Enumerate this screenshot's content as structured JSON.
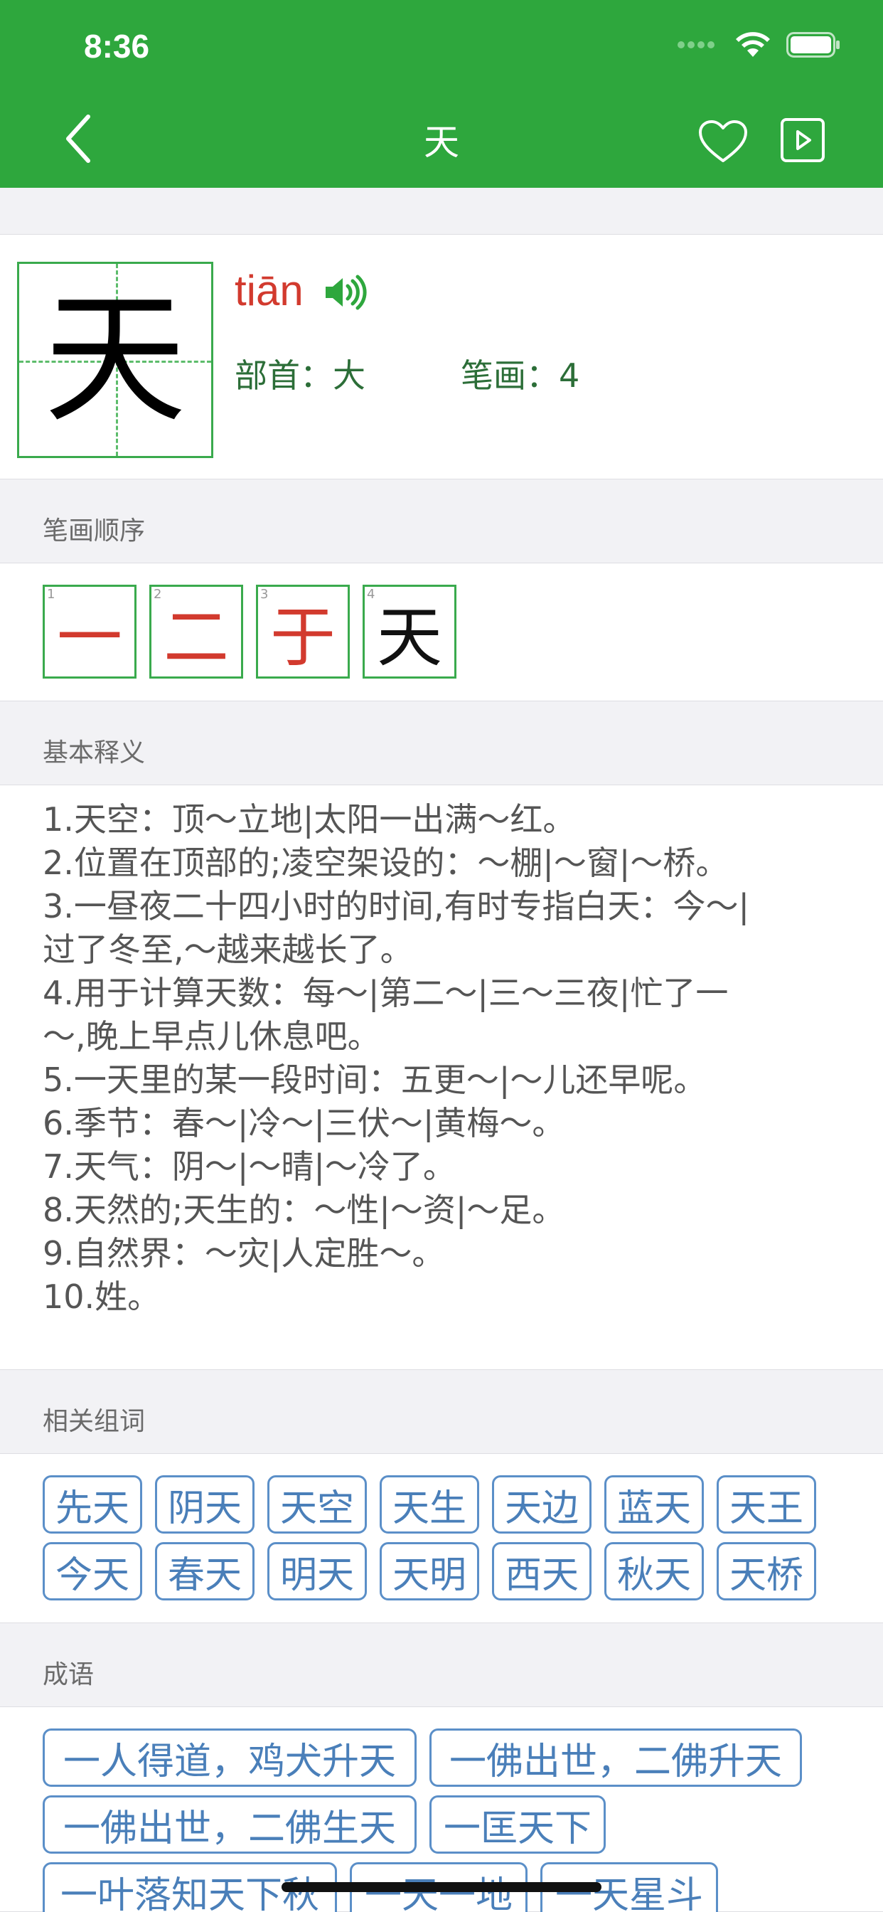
{
  "status_bar": {
    "time": "8:36"
  },
  "nav": {
    "title": "天"
  },
  "character": {
    "glyph": "天",
    "pinyin": "tiān",
    "radical_label": "部首：大",
    "strokes_label": "笔画：4"
  },
  "stroke_order": {
    "heading": "笔画顺序",
    "steps": [
      {
        "num": "1",
        "glyph": "一"
      },
      {
        "num": "2",
        "glyph": "二"
      },
      {
        "num": "3",
        "glyph": "于"
      },
      {
        "num": "4",
        "glyph": "天"
      }
    ]
  },
  "definitions": {
    "heading": "基本释义",
    "lines": [
      "1.天空：顶～立地|太阳一出满～红。",
      "2.位置在顶部的;凌空架设的：～棚|～窗|～桥。",
      "3.一昼夜二十四小时的时间,有时专指白天：今～|",
      "过了冬至,～越来越长了。",
      "4.用于计算天数：每～|第二～|三～三夜|忙了一",
      "～,晚上早点儿休息吧。",
      "5.一天里的某一段时间：五更～|～儿还早呢。",
      "6.季节：春～|冷～|三伏～|黄梅～。",
      "7.天气：阴～|～晴|～冷了。",
      "8.天然的;天生的：～性|～资|～足。",
      "9.自然界：～灾|人定胜～。",
      "10.姓。"
    ]
  },
  "related_words": {
    "heading": "相关组词",
    "words": [
      "先天",
      "阴天",
      "天空",
      "天生",
      "天边",
      "蓝天",
      "天王",
      "今天",
      "春天",
      "明天",
      "天明",
      "西天",
      "秋天",
      "天桥"
    ]
  },
  "idioms": {
    "heading": "成语",
    "items": [
      "一人得道，鸡犬升天",
      "一佛出世，二佛升天",
      "一佛出世，二佛生天",
      "一匡天下",
      "一叶落知天下秋",
      "一天一地",
      "一天星斗"
    ]
  },
  "colors": {
    "primary_green": "#2ea73d",
    "pinyin_red": "#d23a2e",
    "link_blue": "#4a7fb9"
  }
}
